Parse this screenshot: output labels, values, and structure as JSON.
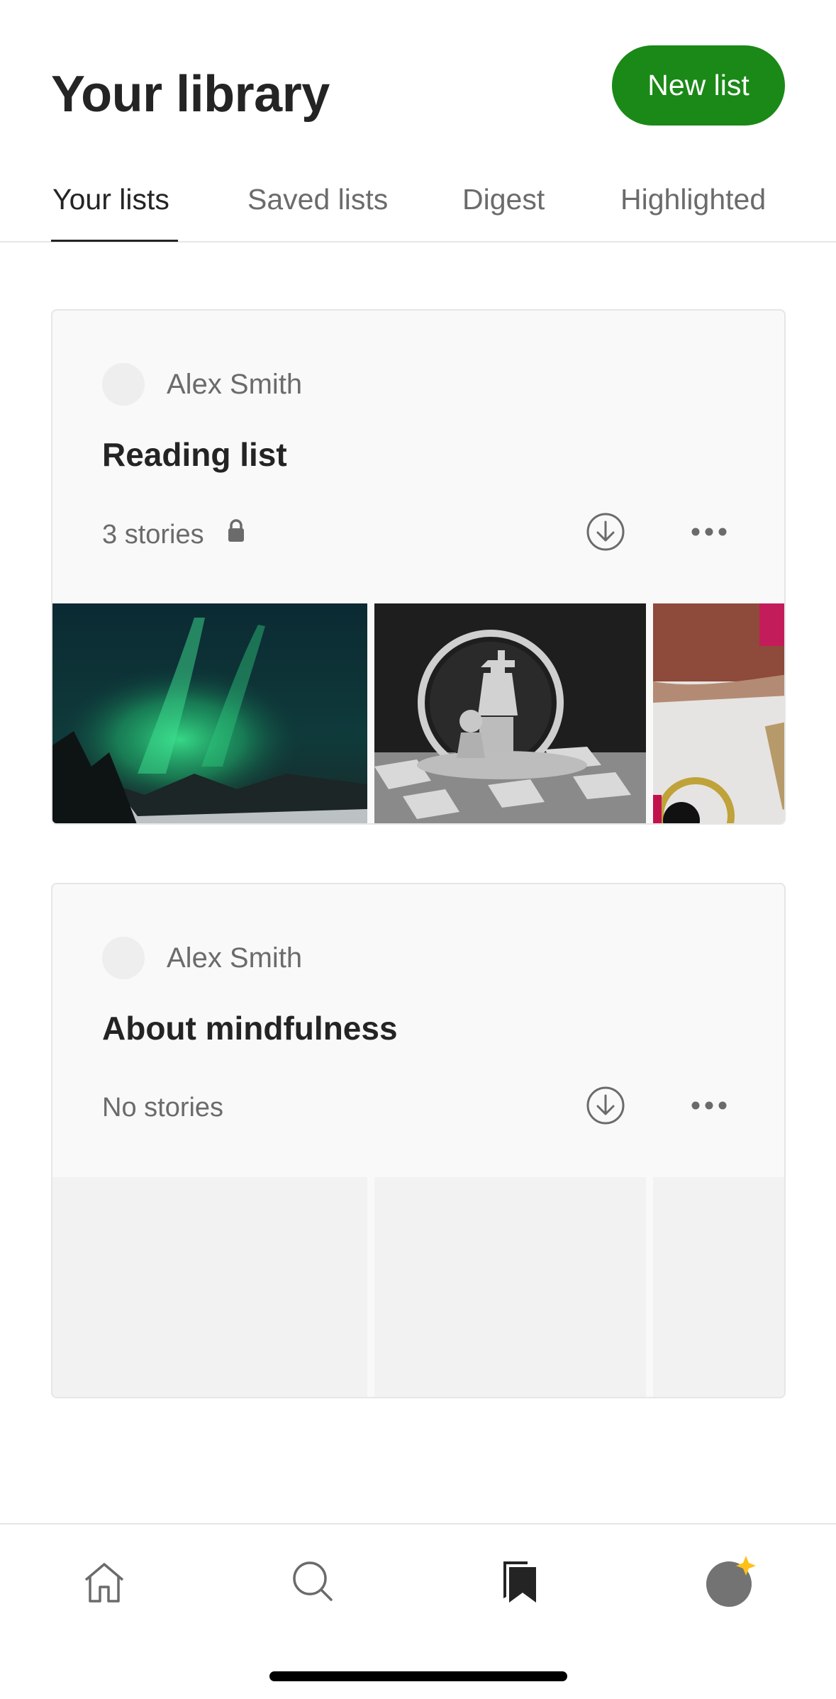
{
  "header": {
    "title": "Your library",
    "new_list_label": "New list"
  },
  "tabs": [
    {
      "label": "Your lists",
      "active": true
    },
    {
      "label": "Saved lists",
      "active": false
    },
    {
      "label": "Digest",
      "active": false
    },
    {
      "label": "Highlighted",
      "active": false
    }
  ],
  "lists": [
    {
      "author": "Alex Smith",
      "title": "Reading list",
      "count": "3 stories",
      "private": true,
      "thumbnails": [
        "aurora-night-sky",
        "chess-king-pawn",
        "desk-still-life"
      ]
    },
    {
      "author": "Alex Smith",
      "title": "About mindfulness",
      "count": "No stories",
      "private": false,
      "thumbnails": []
    }
  ],
  "bottom_nav": [
    {
      "name": "home-icon",
      "active": false
    },
    {
      "name": "search-icon",
      "active": false
    },
    {
      "name": "bookmarks-icon",
      "active": true
    },
    {
      "name": "profile-avatar",
      "active": false
    }
  ],
  "colors": {
    "accent_green": "#1a8917",
    "text_primary": "#242424",
    "text_secondary": "#6b6b6b",
    "star_badge": "#ffc017"
  }
}
